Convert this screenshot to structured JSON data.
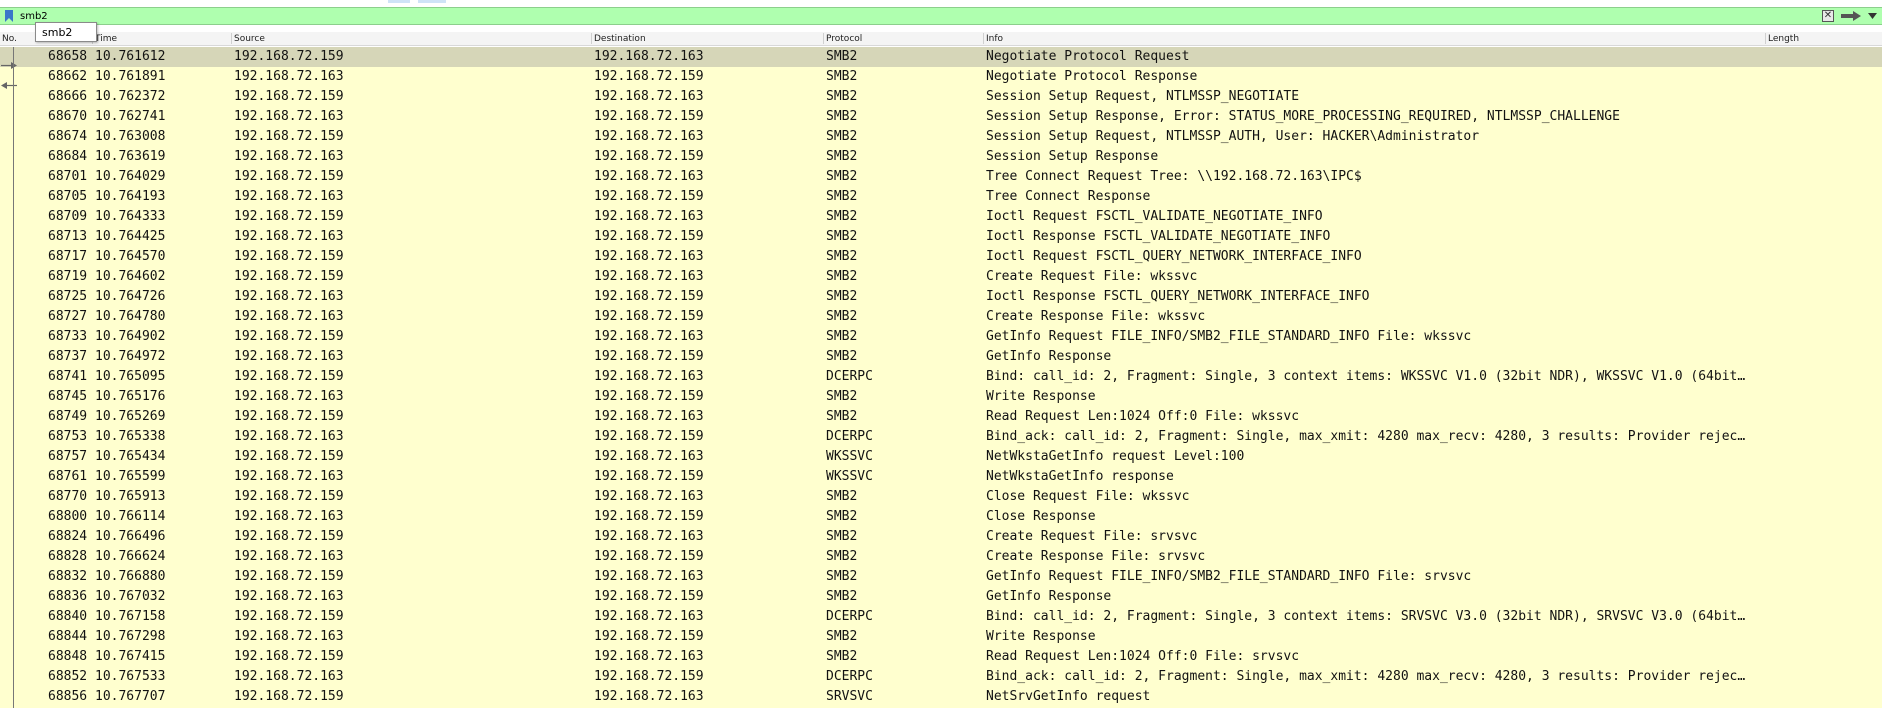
{
  "filter": {
    "value": "smb2",
    "autocomplete": [
      "smb2"
    ],
    "clear_icon": "close-icon",
    "apply_icon": "arrow-right-icon",
    "bookmark_icon": "bookmark-icon",
    "dropdown_icon": "chevron-down-icon",
    "valid_color": "#afffaf"
  },
  "columns": {
    "no": "No.",
    "time": "Time",
    "source": "Source",
    "destination": "Destination",
    "protocol": "Protocol",
    "info": "Info",
    "length": "Length"
  },
  "colors": {
    "row_bg": "#ffffcf",
    "selected_bg": "#d6d6b8"
  },
  "packets": [
    {
      "no": "68658",
      "time": "10.761612",
      "src": "192.168.72.159",
      "dst": "192.168.72.163",
      "proto": "SMB2",
      "info": "Negotiate Protocol Request",
      "selected": true
    },
    {
      "no": "68662",
      "time": "10.761891",
      "src": "192.168.72.163",
      "dst": "192.168.72.159",
      "proto": "SMB2",
      "info": "Negotiate Protocol Response"
    },
    {
      "no": "68666",
      "time": "10.762372",
      "src": "192.168.72.159",
      "dst": "192.168.72.163",
      "proto": "SMB2",
      "info": "Session Setup Request, NTLMSSP_NEGOTIATE"
    },
    {
      "no": "68670",
      "time": "10.762741",
      "src": "192.168.72.163",
      "dst": "192.168.72.159",
      "proto": "SMB2",
      "info": "Session Setup Response, Error: STATUS_MORE_PROCESSING_REQUIRED, NTLMSSP_CHALLENGE"
    },
    {
      "no": "68674",
      "time": "10.763008",
      "src": "192.168.72.159",
      "dst": "192.168.72.163",
      "proto": "SMB2",
      "info": "Session Setup Request, NTLMSSP_AUTH, User: HACKER\\Administrator"
    },
    {
      "no": "68684",
      "time": "10.763619",
      "src": "192.168.72.163",
      "dst": "192.168.72.159",
      "proto": "SMB2",
      "info": "Session Setup Response"
    },
    {
      "no": "68701",
      "time": "10.764029",
      "src": "192.168.72.159",
      "dst": "192.168.72.163",
      "proto": "SMB2",
      "info": "Tree Connect Request Tree: \\\\192.168.72.163\\IPC$"
    },
    {
      "no": "68705",
      "time": "10.764193",
      "src": "192.168.72.163",
      "dst": "192.168.72.159",
      "proto": "SMB2",
      "info": "Tree Connect Response"
    },
    {
      "no": "68709",
      "time": "10.764333",
      "src": "192.168.72.159",
      "dst": "192.168.72.163",
      "proto": "SMB2",
      "info": "Ioctl Request FSCTL_VALIDATE_NEGOTIATE_INFO"
    },
    {
      "no": "68713",
      "time": "10.764425",
      "src": "192.168.72.163",
      "dst": "192.168.72.159",
      "proto": "SMB2",
      "info": "Ioctl Response FSCTL_VALIDATE_NEGOTIATE_INFO"
    },
    {
      "no": "68717",
      "time": "10.764570",
      "src": "192.168.72.159",
      "dst": "192.168.72.163",
      "proto": "SMB2",
      "info": "Ioctl Request FSCTL_QUERY_NETWORK_INTERFACE_INFO"
    },
    {
      "no": "68719",
      "time": "10.764602",
      "src": "192.168.72.159",
      "dst": "192.168.72.163",
      "proto": "SMB2",
      "info": "Create Request File: wkssvc"
    },
    {
      "no": "68725",
      "time": "10.764726",
      "src": "192.168.72.163",
      "dst": "192.168.72.159",
      "proto": "SMB2",
      "info": "Ioctl Response FSCTL_QUERY_NETWORK_INTERFACE_INFO"
    },
    {
      "no": "68727",
      "time": "10.764780",
      "src": "192.168.72.163",
      "dst": "192.168.72.159",
      "proto": "SMB2",
      "info": "Create Response File: wkssvc"
    },
    {
      "no": "68733",
      "time": "10.764902",
      "src": "192.168.72.159",
      "dst": "192.168.72.163",
      "proto": "SMB2",
      "info": "GetInfo Request FILE_INFO/SMB2_FILE_STANDARD_INFO File: wkssvc"
    },
    {
      "no": "68737",
      "time": "10.764972",
      "src": "192.168.72.163",
      "dst": "192.168.72.159",
      "proto": "SMB2",
      "info": "GetInfo Response"
    },
    {
      "no": "68741",
      "time": "10.765095",
      "src": "192.168.72.159",
      "dst": "192.168.72.163",
      "proto": "DCERPC",
      "info": "Bind: call_id: 2, Fragment: Single, 3 context items: WKSSVC V1.0 (32bit NDR), WKSSVC V1.0 (64bit…"
    },
    {
      "no": "68745",
      "time": "10.765176",
      "src": "192.168.72.163",
      "dst": "192.168.72.159",
      "proto": "SMB2",
      "info": "Write Response"
    },
    {
      "no": "68749",
      "time": "10.765269",
      "src": "192.168.72.159",
      "dst": "192.168.72.163",
      "proto": "SMB2",
      "info": "Read Request Len:1024 Off:0 File: wkssvc"
    },
    {
      "no": "68753",
      "time": "10.765338",
      "src": "192.168.72.163",
      "dst": "192.168.72.159",
      "proto": "DCERPC",
      "info": "Bind_ack: call_id: 2, Fragment: Single, max_xmit: 4280 max_recv: 4280, 3 results: Provider rejec…"
    },
    {
      "no": "68757",
      "time": "10.765434",
      "src": "192.168.72.159",
      "dst": "192.168.72.163",
      "proto": "WKSSVC",
      "info": "NetWkstaGetInfo request Level:100"
    },
    {
      "no": "68761",
      "time": "10.765599",
      "src": "192.168.72.163",
      "dst": "192.168.72.159",
      "proto": "WKSSVC",
      "info": "NetWkstaGetInfo response"
    },
    {
      "no": "68770",
      "time": "10.765913",
      "src": "192.168.72.159",
      "dst": "192.168.72.163",
      "proto": "SMB2",
      "info": "Close Request File: wkssvc"
    },
    {
      "no": "68800",
      "time": "10.766114",
      "src": "192.168.72.163",
      "dst": "192.168.72.159",
      "proto": "SMB2",
      "info": "Close Response"
    },
    {
      "no": "68824",
      "time": "10.766496",
      "src": "192.168.72.159",
      "dst": "192.168.72.163",
      "proto": "SMB2",
      "info": "Create Request File: srvsvc"
    },
    {
      "no": "68828",
      "time": "10.766624",
      "src": "192.168.72.163",
      "dst": "192.168.72.159",
      "proto": "SMB2",
      "info": "Create Response File: srvsvc"
    },
    {
      "no": "68832",
      "time": "10.766880",
      "src": "192.168.72.159",
      "dst": "192.168.72.163",
      "proto": "SMB2",
      "info": "GetInfo Request FILE_INFO/SMB2_FILE_STANDARD_INFO File: srvsvc"
    },
    {
      "no": "68836",
      "time": "10.767032",
      "src": "192.168.72.163",
      "dst": "192.168.72.159",
      "proto": "SMB2",
      "info": "GetInfo Response"
    },
    {
      "no": "68840",
      "time": "10.767158",
      "src": "192.168.72.159",
      "dst": "192.168.72.163",
      "proto": "DCERPC",
      "info": "Bind: call_id: 2, Fragment: Single, 3 context items: SRVSVC V3.0 (32bit NDR), SRVSVC V3.0 (64bit…"
    },
    {
      "no": "68844",
      "time": "10.767298",
      "src": "192.168.72.163",
      "dst": "192.168.72.159",
      "proto": "SMB2",
      "info": "Write Response"
    },
    {
      "no": "68848",
      "time": "10.767415",
      "src": "192.168.72.159",
      "dst": "192.168.72.163",
      "proto": "SMB2",
      "info": "Read Request Len:1024 Off:0 File: srvsvc"
    },
    {
      "no": "68852",
      "time": "10.767533",
      "src": "192.168.72.163",
      "dst": "192.168.72.159",
      "proto": "DCERPC",
      "info": "Bind_ack: call_id: 2, Fragment: Single, max_xmit: 4280 max_recv: 4280, 3 results: Provider rejec…"
    },
    {
      "no": "68856",
      "time": "10.767707",
      "src": "192.168.72.159",
      "dst": "192.168.72.163",
      "proto": "SRVSVC",
      "info": "NetSrvGetInfo request"
    }
  ]
}
